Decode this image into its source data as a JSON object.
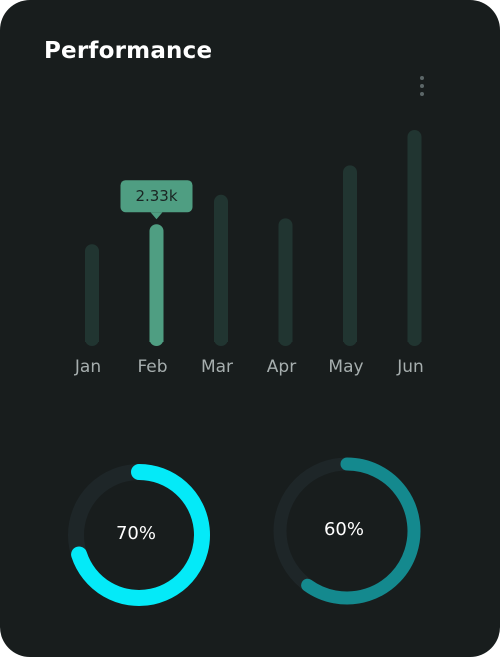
{
  "card": {
    "title": "Performance",
    "menu_icon": "more-vertical-icon"
  },
  "colors": {
    "background": "#181d1d",
    "bar": "#213531",
    "bar_active": "#4f9e82",
    "tooltip": "#4f9e82",
    "gauge_track": "#1e2628",
    "gauge_1": "#04eaf8",
    "gauge_2": "#14898e"
  },
  "chart_data": [
    {
      "type": "bar",
      "title": "Performance",
      "categories": [
        "Jan",
        "Feb",
        "Mar",
        "Apr",
        "May",
        "Jun"
      ],
      "values": [
        1.66,
        2.0,
        2.5,
        2.1,
        3.0,
        3.6
      ],
      "highlight": {
        "category": "Feb",
        "label": "2.33k"
      },
      "ylim": [
        0,
        3.6
      ],
      "grid": false,
      "xlabel": "",
      "ylabel": ""
    },
    {
      "type": "pie",
      "values": [
        70,
        30
      ],
      "label": "70%"
    },
    {
      "type": "pie",
      "values": [
        60,
        40
      ],
      "label": "60%"
    }
  ]
}
